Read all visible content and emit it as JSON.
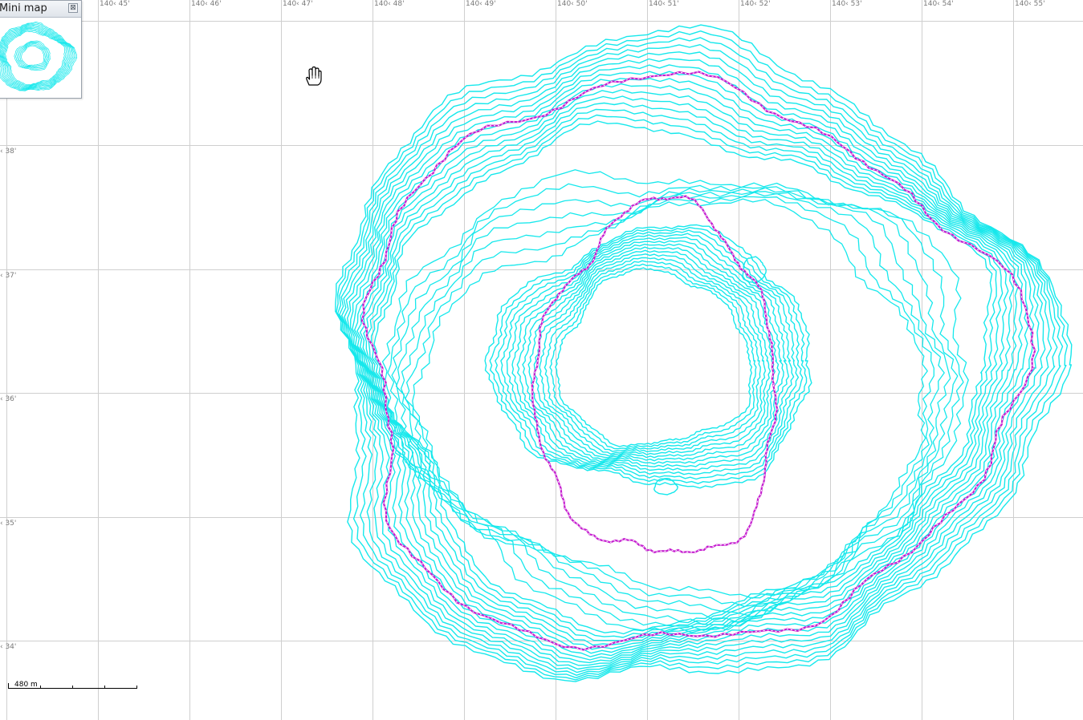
{
  "map": {
    "longitude_labels": [
      "140‹ 45'",
      "140‹ 46'",
      "140‹ 47'",
      "140‹ 48'",
      "140‹ 49'",
      "140‹ 50'",
      "140‹ 51'",
      "140‹ 52'",
      "140‹ 53'",
      "140‹ 54'",
      "140‹ 55'"
    ],
    "latitude_labels": [
      "‹ 38'",
      "‹ 37'",
      "‹ 36'",
      "‹ 35'",
      "‹ 34'"
    ],
    "colors": {
      "contour": "#16e8ec",
      "highlight_contour": "#c51ccf",
      "grid": "#cfcfcf",
      "background": "#ffffff"
    },
    "cursor_icon": "hand-pan-icon"
  },
  "mini_map": {
    "title": "Mini map",
    "close_symbol": "⊠"
  },
  "scale": {
    "label": "480 m"
  }
}
